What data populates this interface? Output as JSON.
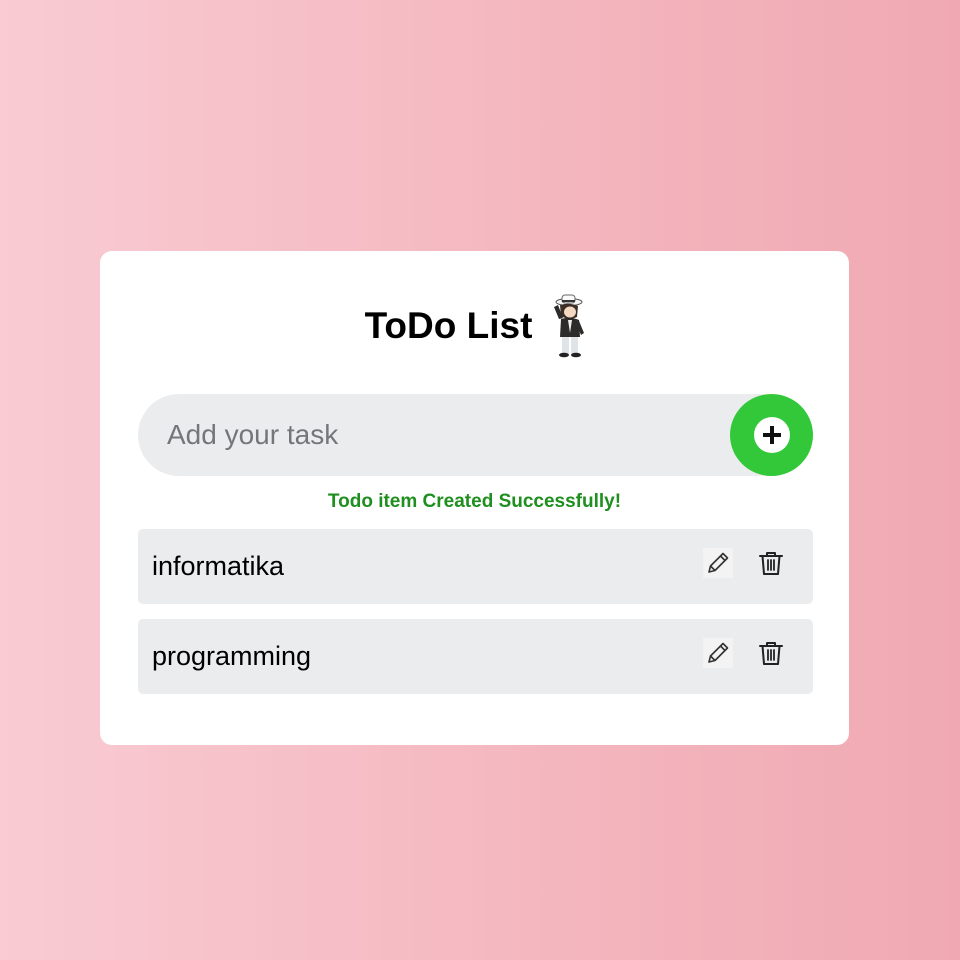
{
  "header": {
    "title": "ToDo List",
    "mascot_icon": "mascot-character-icon"
  },
  "input": {
    "placeholder": "Add your task",
    "value": ""
  },
  "add_button": {
    "icon": "plus-icon",
    "color": "#33c839"
  },
  "status": {
    "message": "Todo item Created Successfully!",
    "color": "#1f8f1f"
  },
  "todos": [
    {
      "text": "informatika",
      "edit_icon": "pencil-icon",
      "delete_icon": "trash-icon"
    },
    {
      "text": "programming",
      "edit_icon": "pencil-icon",
      "delete_icon": "trash-icon"
    }
  ]
}
